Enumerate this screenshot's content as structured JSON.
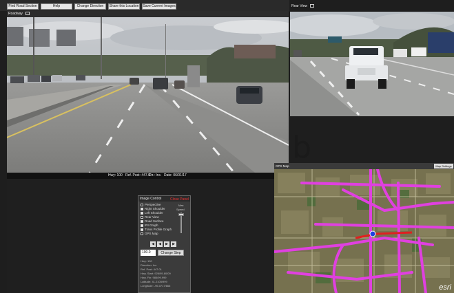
{
  "toolbar": {
    "buttons": [
      "Find Road Section",
      "Help",
      "Change Direction",
      "Share this Location",
      "Save Current Images"
    ]
  },
  "roadway": {
    "title": "Roadway"
  },
  "rear_view": {
    "title": "Rear View"
  },
  "info_strip": {
    "hwy": "Hwy: 100",
    "ref_post": "Ref. Post: 447.0",
    "dir": "Dir.: Inc.",
    "date": "Date: 06/01/17"
  },
  "overlay_letter": "b",
  "image_control": {
    "title": "Image Control",
    "close": "Close Panel",
    "checkboxes": [
      {
        "label": "Perspective",
        "checked": true
      },
      {
        "label": "Right Shoulder",
        "checked": false
      },
      {
        "label": "Left Shoulder",
        "checked": false
      },
      {
        "label": "Rear View",
        "checked": true
      },
      {
        "label": "Road Surface",
        "checked": false
      },
      {
        "label": "IRI Graph",
        "checked": false
      },
      {
        "label": "Trans Profile Graph",
        "checked": false
      },
      {
        "label": "GPS Map",
        "checked": true
      }
    ],
    "speed_max": "Max",
    "speed_label": "Speed",
    "step_value": "100.0",
    "change_step": "Change Step",
    "meta": [
      "Hwy: 100",
      "Direction: Inc",
      "Ref. Post: 447.01",
      "Hwy. Start: 926/95.80/09",
      "Hwy. Fin: 985/99.999",
      "Latitude: 41.2105/999",
      "Longitude: -96.0717/666"
    ]
  },
  "gps": {
    "title": "GPS Map",
    "map_settings": "Map Settings",
    "logo": "esri"
  },
  "colors": {
    "route": "#e040e0",
    "route_active": "#e02020",
    "position": "#2040e0"
  }
}
